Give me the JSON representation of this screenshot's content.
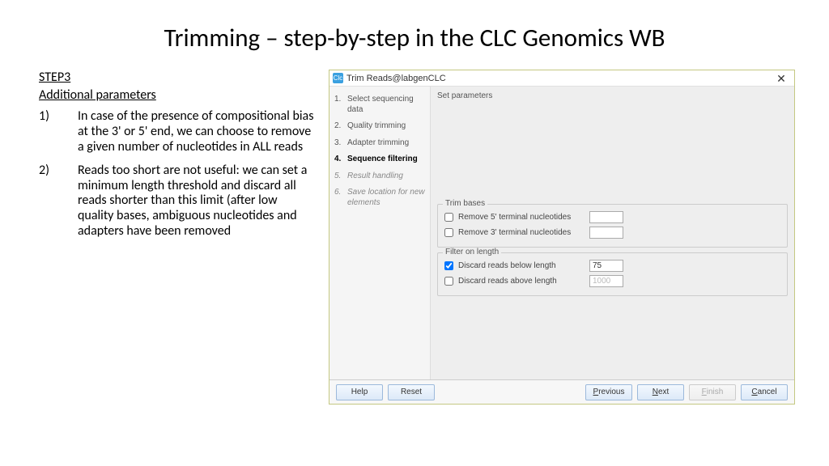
{
  "slide": {
    "title": "Trimming – step-by-step in the CLC Genomics WB",
    "step_label": "STEP3",
    "subtitle": "Additional parameters",
    "items": [
      {
        "num": "1)",
        "text": "In case of the presence of compositional bias at the 3' or 5' end, we can choose to remove a given number of nucleotides in ALL reads"
      },
      {
        "num": "2)",
        "text": "Reads too short are not useful: we can set a minimum length threshold and discard all reads shorter than this limit (after low quality bases, ambiguous nucleotides and adapters have been removed"
      }
    ]
  },
  "dialog": {
    "title": "Trim Reads@labgenCLC",
    "close": "✕",
    "steps": [
      {
        "n": "1.",
        "label": "Select sequencing data"
      },
      {
        "n": "2.",
        "label": "Quality trimming"
      },
      {
        "n": "3.",
        "label": "Adapter trimming"
      },
      {
        "n": "4.",
        "label": "Sequence filtering",
        "active": true
      },
      {
        "n": "5.",
        "label": "Result handling",
        "italic": true
      },
      {
        "n": "6.",
        "label": "Save location for new elements",
        "italic": true
      }
    ],
    "panel_header": "Set parameters",
    "trim_bases": {
      "legend": "Trim bases",
      "remove5_lbl": "Remove 5' terminal nucleotides",
      "remove5_checked": false,
      "remove5_val": "",
      "remove3_lbl": "Remove 3' terminal nucleotides",
      "remove3_checked": false,
      "remove3_val": ""
    },
    "filter_length": {
      "legend": "Filter on length",
      "below_lbl": "Discard reads below length",
      "below_checked": true,
      "below_val": "75",
      "above_lbl": "Discard reads above length",
      "above_checked": false,
      "above_val": "1000"
    },
    "buttons": {
      "help": "Help",
      "reset": "Reset",
      "previous_u": "P",
      "previous_rest": "revious",
      "next_u": "N",
      "next_rest": "ext",
      "finish_u": "F",
      "finish_rest": "inish",
      "cancel_u": "C",
      "cancel_rest": "ancel"
    }
  }
}
